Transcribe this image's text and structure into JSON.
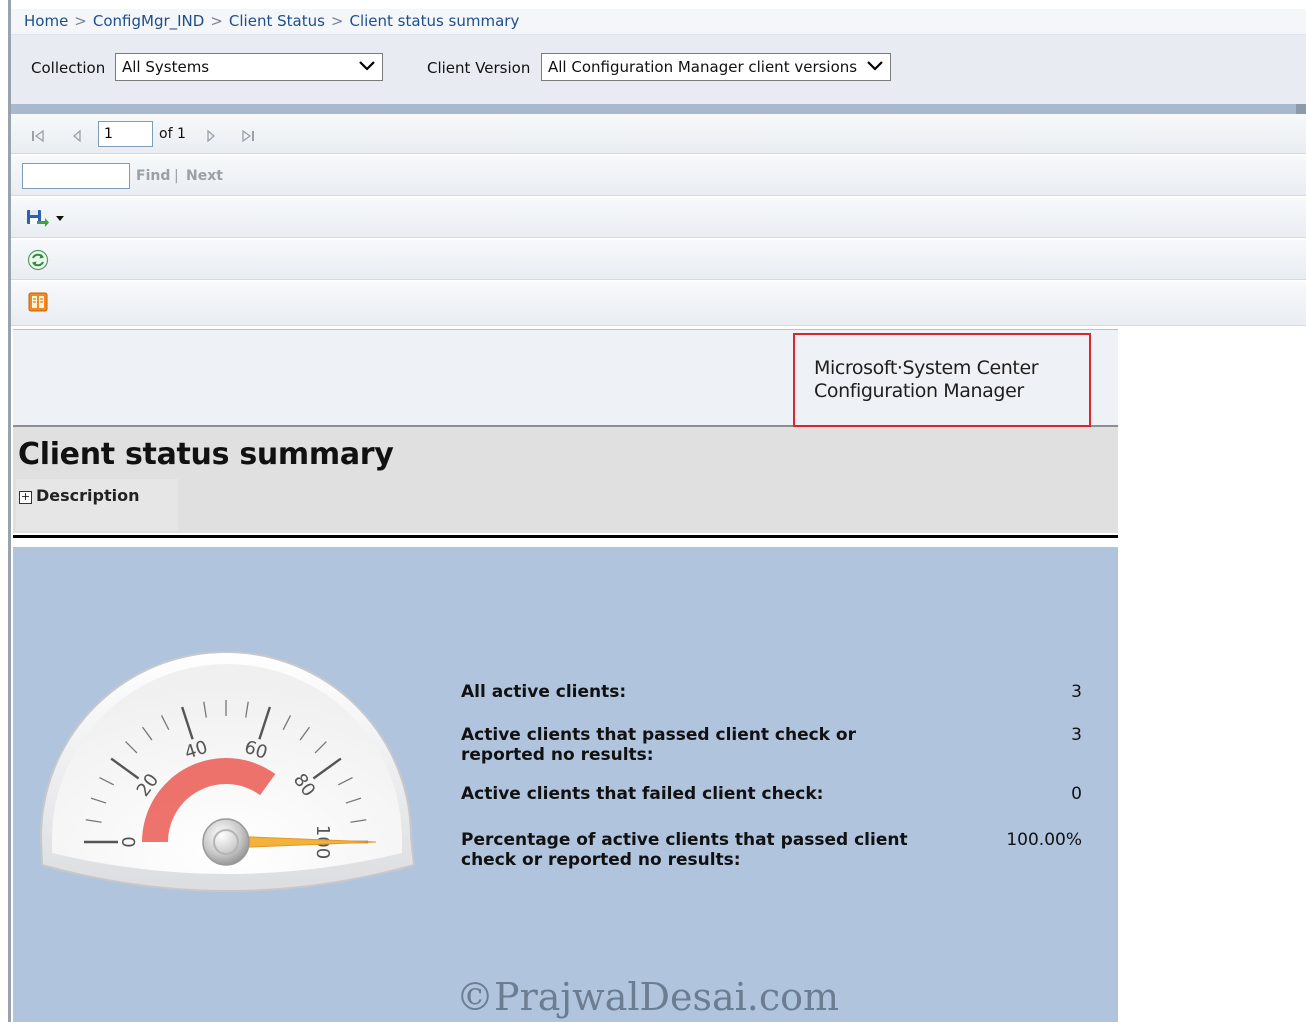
{
  "breadcrumb": {
    "items": [
      "Home",
      "ConfigMgr_IND",
      "Client Status",
      "Client status summary"
    ],
    "separator": ">"
  },
  "parameters": {
    "collection_label": "Collection",
    "collection_value": "All Systems",
    "client_version_label": "Client Version",
    "client_version_value": "All Configuration Manager client versions"
  },
  "paging": {
    "current_page": "1",
    "of_label": "of 1"
  },
  "find": {
    "find_label": "Find",
    "separator": "|",
    "next_label": "Next"
  },
  "toolbar": {
    "icons": [
      "save-export-icon",
      "refresh-icon",
      "print-icon"
    ]
  },
  "report_header": {
    "logo_line1": "Microsoft·System Center",
    "logo_line2": "Configuration Manager"
  },
  "report": {
    "title": "Client status summary",
    "description_toggle": "Description"
  },
  "gauge": {
    "min": 0,
    "max": 100,
    "ticks": [
      "0",
      "20",
      "40",
      "60",
      "80",
      "100"
    ],
    "value": 100,
    "range_low": 0,
    "range_high": 70,
    "range_color": "#ea5a52",
    "needle_color": "#f3b23b"
  },
  "metrics": [
    {
      "label": "All active clients:",
      "value": "3"
    },
    {
      "label": "Active clients that passed client check or reported no results:",
      "value": "3"
    },
    {
      "label": "Active clients that failed client check:",
      "value": "0"
    },
    {
      "label": "Percentage of active clients that passed client check or reported no results:",
      "value": "100.00%"
    }
  ],
  "watermark": "©PrajwalDesai.com",
  "colors": {
    "panel": "#b0c4de",
    "link": "#1d4f8c",
    "highlight_box": "#d7262e"
  }
}
